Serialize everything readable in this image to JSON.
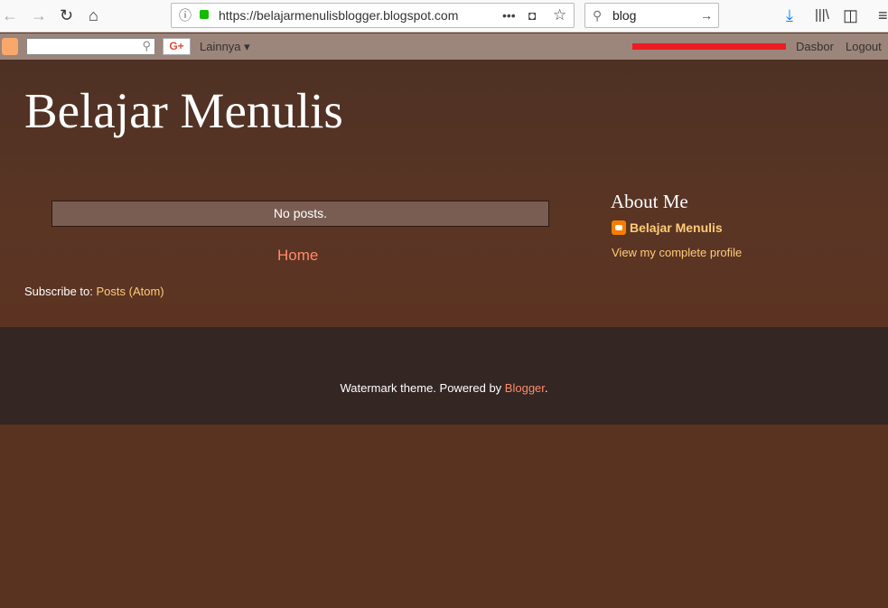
{
  "browser": {
    "url": "https://belajarmenulisblogger.blogspot.com",
    "search_value": "blog"
  },
  "navbar": {
    "more_label": "Lainnya ▾",
    "dashboard_label": "Dasbor",
    "logout_label": "Logout",
    "gplus_label": "G+",
    "redaction_color": "#ed1c24"
  },
  "blog": {
    "title": "Belajar Menulis",
    "no_posts": "No posts.",
    "home_link": "Home",
    "subscribe_prefix": "Subscribe to: ",
    "subscribe_link": "Posts (Atom)"
  },
  "sidebar": {
    "heading": "About Me",
    "profile_name": "Belajar Menulis",
    "view_profile": "View my complete profile"
  },
  "footer": {
    "text": "Watermark theme. Powered by ",
    "link": "Blogger",
    "suffix": "."
  }
}
